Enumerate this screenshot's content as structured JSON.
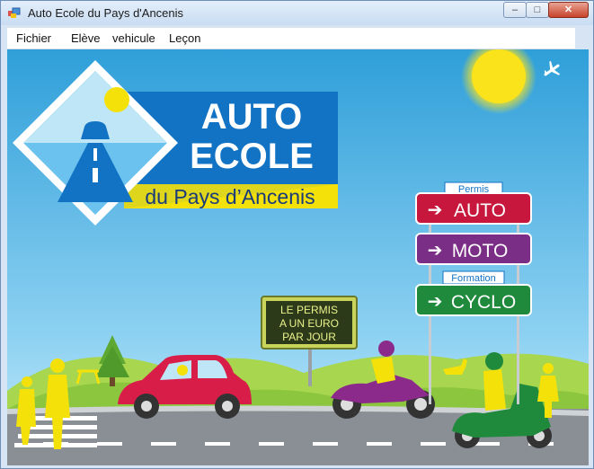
{
  "window": {
    "title": "Auto Ecole du Pays d'Ancenis",
    "controls": {
      "minimize": "–",
      "maximize": "□",
      "close": "✕"
    }
  },
  "menu": {
    "items": [
      "Fichier",
      "Elève",
      "vehicule",
      "Leçon"
    ]
  },
  "logo": {
    "line1": "AUTO",
    "line2": "ECOLE",
    "line3": "du Pays d’Ancenis"
  },
  "signs": {
    "permis_label": "Permis",
    "auto": "AUTO",
    "moto": "MOTO",
    "formation_label": "Formation",
    "cyclo": "CYCLO",
    "arrow": "➔"
  },
  "billboard": {
    "line1": "LE PERMIS",
    "line2": "A UN EURO",
    "line3": "PAR JOUR"
  },
  "colors": {
    "sky_top": "#2f9fd9",
    "sky_bottom": "#b9e4f7",
    "grass": "#8cc63f",
    "road": "#8a8f95",
    "auto_sign": "#c8173c",
    "moto_sign": "#7b2e86",
    "cyclo_sign": "#1f8a3b",
    "logo_blue": "#1273c4",
    "logo_yellow": "#f4e10a"
  }
}
